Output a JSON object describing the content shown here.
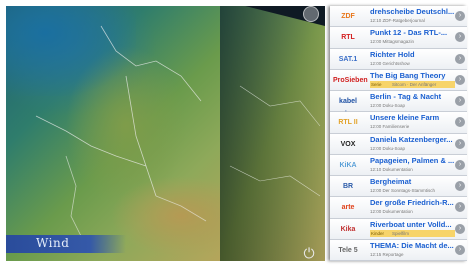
{
  "map": {
    "overlay_label": "Wind"
  },
  "controls": {
    "power_icon": "power-icon",
    "slider_icon": "slider-handle-icon"
  },
  "programs": [
    {
      "channel": "ZDF",
      "logo_color": "#e8781c",
      "title": "drehscheibe Deutschl...",
      "subtitle": "12:10 ZDF-Ratgeberjournal"
    },
    {
      "channel": "RTL",
      "logo_color": "#d41e1e",
      "title": "Punkt 12 - Das RTL-...",
      "subtitle": "12:00 Mittagsmagazin"
    },
    {
      "channel": "SAT.1",
      "logo_color": "#3a6ec7",
      "title": "Richter Hold",
      "subtitle": "12:00 Gerichtsshow"
    },
    {
      "channel": "ProSieben",
      "logo_color": "#d01e1e",
      "title": "The Big Bang Theory",
      "subtitle": "Sitcom · Der Anfänger",
      "tag": "Serie"
    },
    {
      "channel": "kabel eins",
      "logo_color": "#1d4fa3",
      "title": "Berlin - Tag & Nacht",
      "subtitle": "12:00 Doku-Soap"
    },
    {
      "channel": "RTL II",
      "logo_color": "#e2a22a",
      "title": "Unsere kleine Farm",
      "subtitle": "12:00 Familienserie"
    },
    {
      "channel": "VOX",
      "logo_color": "#222222",
      "title": "Daniela Katzenberger...",
      "subtitle": "12:00 Doku-Soap"
    },
    {
      "channel": "KiKA",
      "logo_color": "#5aa0d8",
      "title": "Papageien, Palmen & ...",
      "subtitle": "12:10 Dokumentation"
    },
    {
      "channel": "BR",
      "logo_color": "#2a5aa8",
      "title": "Bergheimat",
      "subtitle": "12:00 Der Sonntags-Stammtisch"
    },
    {
      "channel": "arte",
      "logo_color": "#e0421b",
      "title": "Der große Friedrich-R...",
      "subtitle": "12:00 Dokumentation"
    },
    {
      "channel": "Kika",
      "logo_color": "#c03030",
      "title": "Riverboat unter Volld...",
      "subtitle": "Spielfilm",
      "tag": "Kinder"
    },
    {
      "channel": "Tele 5",
      "logo_color": "#666666",
      "title": "THEMA: Die Macht de...",
      "subtitle": "12:15 Reportage"
    }
  ]
}
